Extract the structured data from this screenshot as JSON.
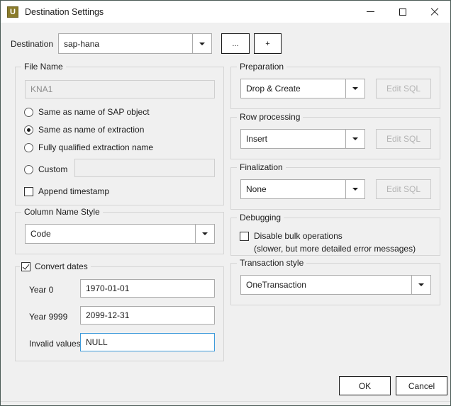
{
  "window": {
    "title": "Destination Settings",
    "icon": "app-u-icon",
    "icon_letter": "U",
    "accent_color": "#8a7b2a",
    "controls": {
      "minimize": "minimize-icon",
      "maximize": "maximize-icon",
      "close": "close-icon"
    }
  },
  "destination": {
    "label": "Destination",
    "value": "sap-hana",
    "browse_button": "...",
    "add_button": "+"
  },
  "file_name": {
    "title": "File Name",
    "name_value": "KNA1",
    "options": [
      {
        "label": "Same as name of SAP object",
        "selected": false
      },
      {
        "label": "Same as name of extraction",
        "selected": true
      },
      {
        "label": "Fully qualified extraction name",
        "selected": false
      },
      {
        "label": "Custom",
        "selected": false
      }
    ],
    "custom_value": "",
    "append_timestamp": {
      "label": "Append timestamp",
      "checked": false
    }
  },
  "column_name_style": {
    "title": "Column Name Style",
    "value": "Code"
  },
  "convert_dates": {
    "title": "Convert dates",
    "checked": true,
    "fields": [
      {
        "label": "Year 0",
        "value": "1970-01-01",
        "focused": false
      },
      {
        "label": "Year 9999",
        "value": "2099-12-31",
        "focused": false
      },
      {
        "label": "Invalid values",
        "value": "NULL",
        "focused": true
      }
    ],
    "focus_color": "#3f9bda"
  },
  "preparation": {
    "title": "Preparation",
    "value": "Drop & Create",
    "edit_sql_label": "Edit SQL",
    "edit_sql_enabled": false
  },
  "row_processing": {
    "title": "Row processing",
    "value": "Insert",
    "edit_sql_label": "Edit SQL",
    "edit_sql_enabled": false
  },
  "finalization": {
    "title": "Finalization",
    "value": "None",
    "edit_sql_label": "Edit SQL",
    "edit_sql_enabled": false
  },
  "debugging": {
    "title": "Debugging",
    "disable_bulk": {
      "label": "Disable bulk operations",
      "checked": false
    },
    "note": "(slower, but more detailed error messages)"
  },
  "transaction_style": {
    "title": "Transaction style",
    "value": "OneTransaction"
  },
  "footer": {
    "ok_label": "OK",
    "cancel_label": "Cancel"
  }
}
